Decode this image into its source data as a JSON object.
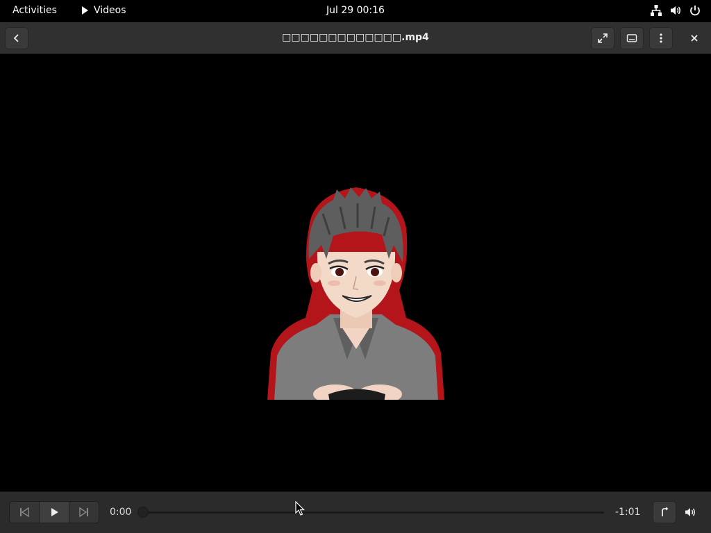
{
  "topbar": {
    "activities": "Activities",
    "app_name": "Videos",
    "clock": "Jul 29  00:16"
  },
  "header": {
    "title": "□□□□□□□□□□□□□.mp4"
  },
  "video": {
    "content": "anime-style man with gray hair holding a game controller"
  },
  "controls": {
    "elapsed": "0:00",
    "remaining": "-1:01",
    "progress_fraction": 0
  },
  "colors": {
    "panel": "#000000",
    "headerbar": "#303030",
    "controls": "#2b2b2b",
    "glow": "#c0181e"
  }
}
